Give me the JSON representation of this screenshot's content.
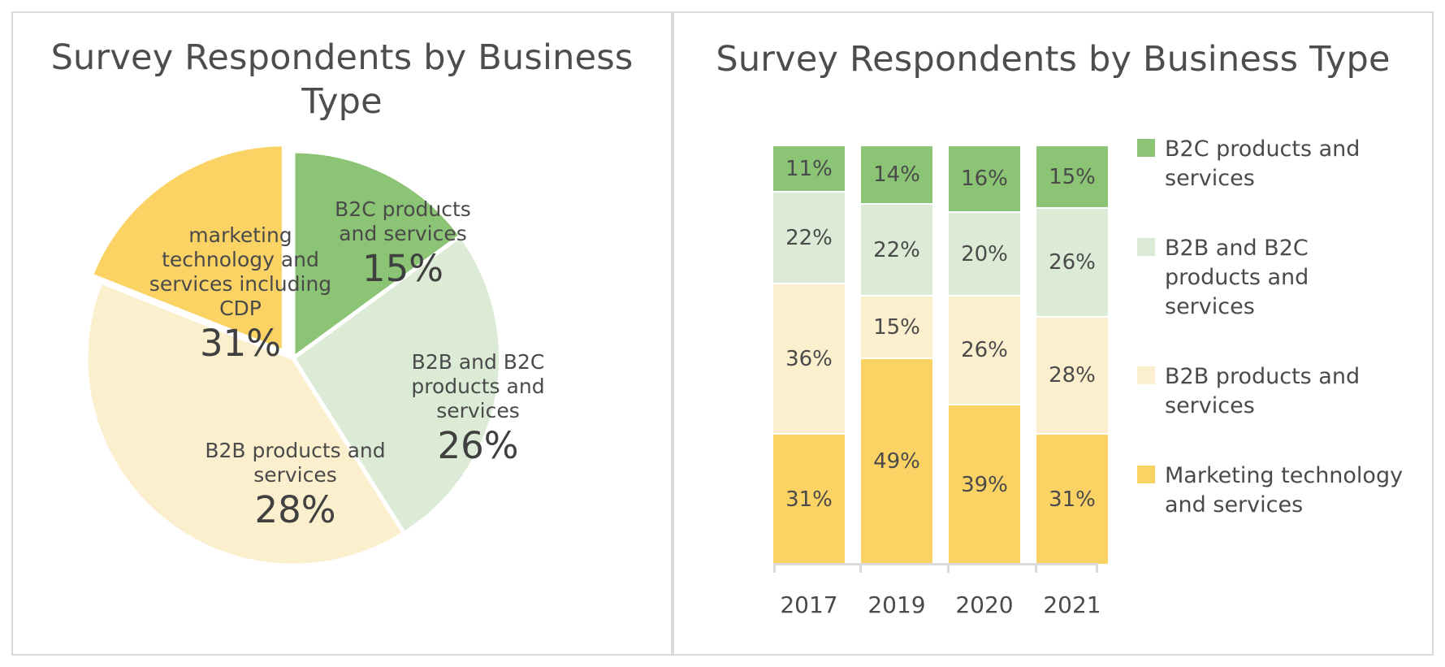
{
  "colors": {
    "b2c": "#8BC474",
    "b2b_b2c": "#DCEBD6",
    "b2b": "#FCEFCD",
    "martech": "#FBD264",
    "text": "#4a4a4a",
    "border": "#d9d9d9",
    "axis": "#d9d9d9"
  },
  "pie_panel": {
    "title": "Survey Respondents by Business Type"
  },
  "bar_panel": {
    "title": "Survey Respondents by Business Type"
  },
  "legend": {
    "items": [
      {
        "label": "B2C products and services",
        "color": "#8BC474"
      },
      {
        "label": "B2B and B2C products and services",
        "color": "#DCEBD6"
      },
      {
        "label": "B2B products and services",
        "color": "#FCEFCD"
      },
      {
        "label": "Marketing technology and services",
        "color": "#FBD264"
      }
    ]
  },
  "chart_data": [
    {
      "type": "pie",
      "title": "Survey Respondents by Business Type",
      "labels": [
        "B2C products and services",
        "B2B and B2C products and services",
        "B2B products and services",
        "marketing technology and services including CDP"
      ],
      "values": [
        15,
        26,
        28,
        31
      ],
      "value_labels": [
        "15%",
        "26%",
        "28%",
        "31%"
      ],
      "colors": [
        "#8BC474",
        "#DCEBD6",
        "#FCEFCD",
        "#FBD264"
      ],
      "exploded_slice": "marketing technology and services including CDP",
      "legend": "none (labels drawn inside slices)"
    },
    {
      "type": "bar",
      "subtype": "100% stacked column",
      "title": "Survey Respondents by Business Type",
      "xlabel": "",
      "ylabel": "",
      "ylim": [
        0,
        100
      ],
      "grid": false,
      "legend_position": "right",
      "categories": [
        "2017",
        "2019",
        "2020",
        "2021"
      ],
      "series": [
        {
          "name": "Marketing technology and services",
          "color": "#FBD264",
          "values": [
            31,
            49,
            39,
            31
          ]
        },
        {
          "name": "B2B products and services",
          "color": "#FCEFCD",
          "values": [
            36,
            15,
            26,
            28
          ]
        },
        {
          "name": "B2B and B2C products and services",
          "color": "#DCEBD6",
          "values": [
            22,
            22,
            20,
            26
          ]
        },
        {
          "name": "B2C products and services",
          "color": "#8BC474",
          "values": [
            11,
            14,
            16,
            15
          ]
        }
      ],
      "data_labels": {
        "2017": {
          "B2C products and services": "11%",
          "B2B and B2C products and services": "22%",
          "B2B products and services": "36%",
          "Marketing technology and services": "31%"
        },
        "2019": {
          "B2C products and services": "14%",
          "B2B and B2C products and services": "22%",
          "B2B products and services": "15%",
          "Marketing technology and services": "49%"
        },
        "2020": {
          "B2C products and services": "16%",
          "B2B and B2C products and services": "20%",
          "B2B products and services": "26%",
          "Marketing technology and services": "39%"
        },
        "2021": {
          "B2C products and services": "15%",
          "B2B and B2C products and services": "26%",
          "B2B products and services": "28%",
          "Marketing technology and services": "31%"
        }
      }
    }
  ]
}
